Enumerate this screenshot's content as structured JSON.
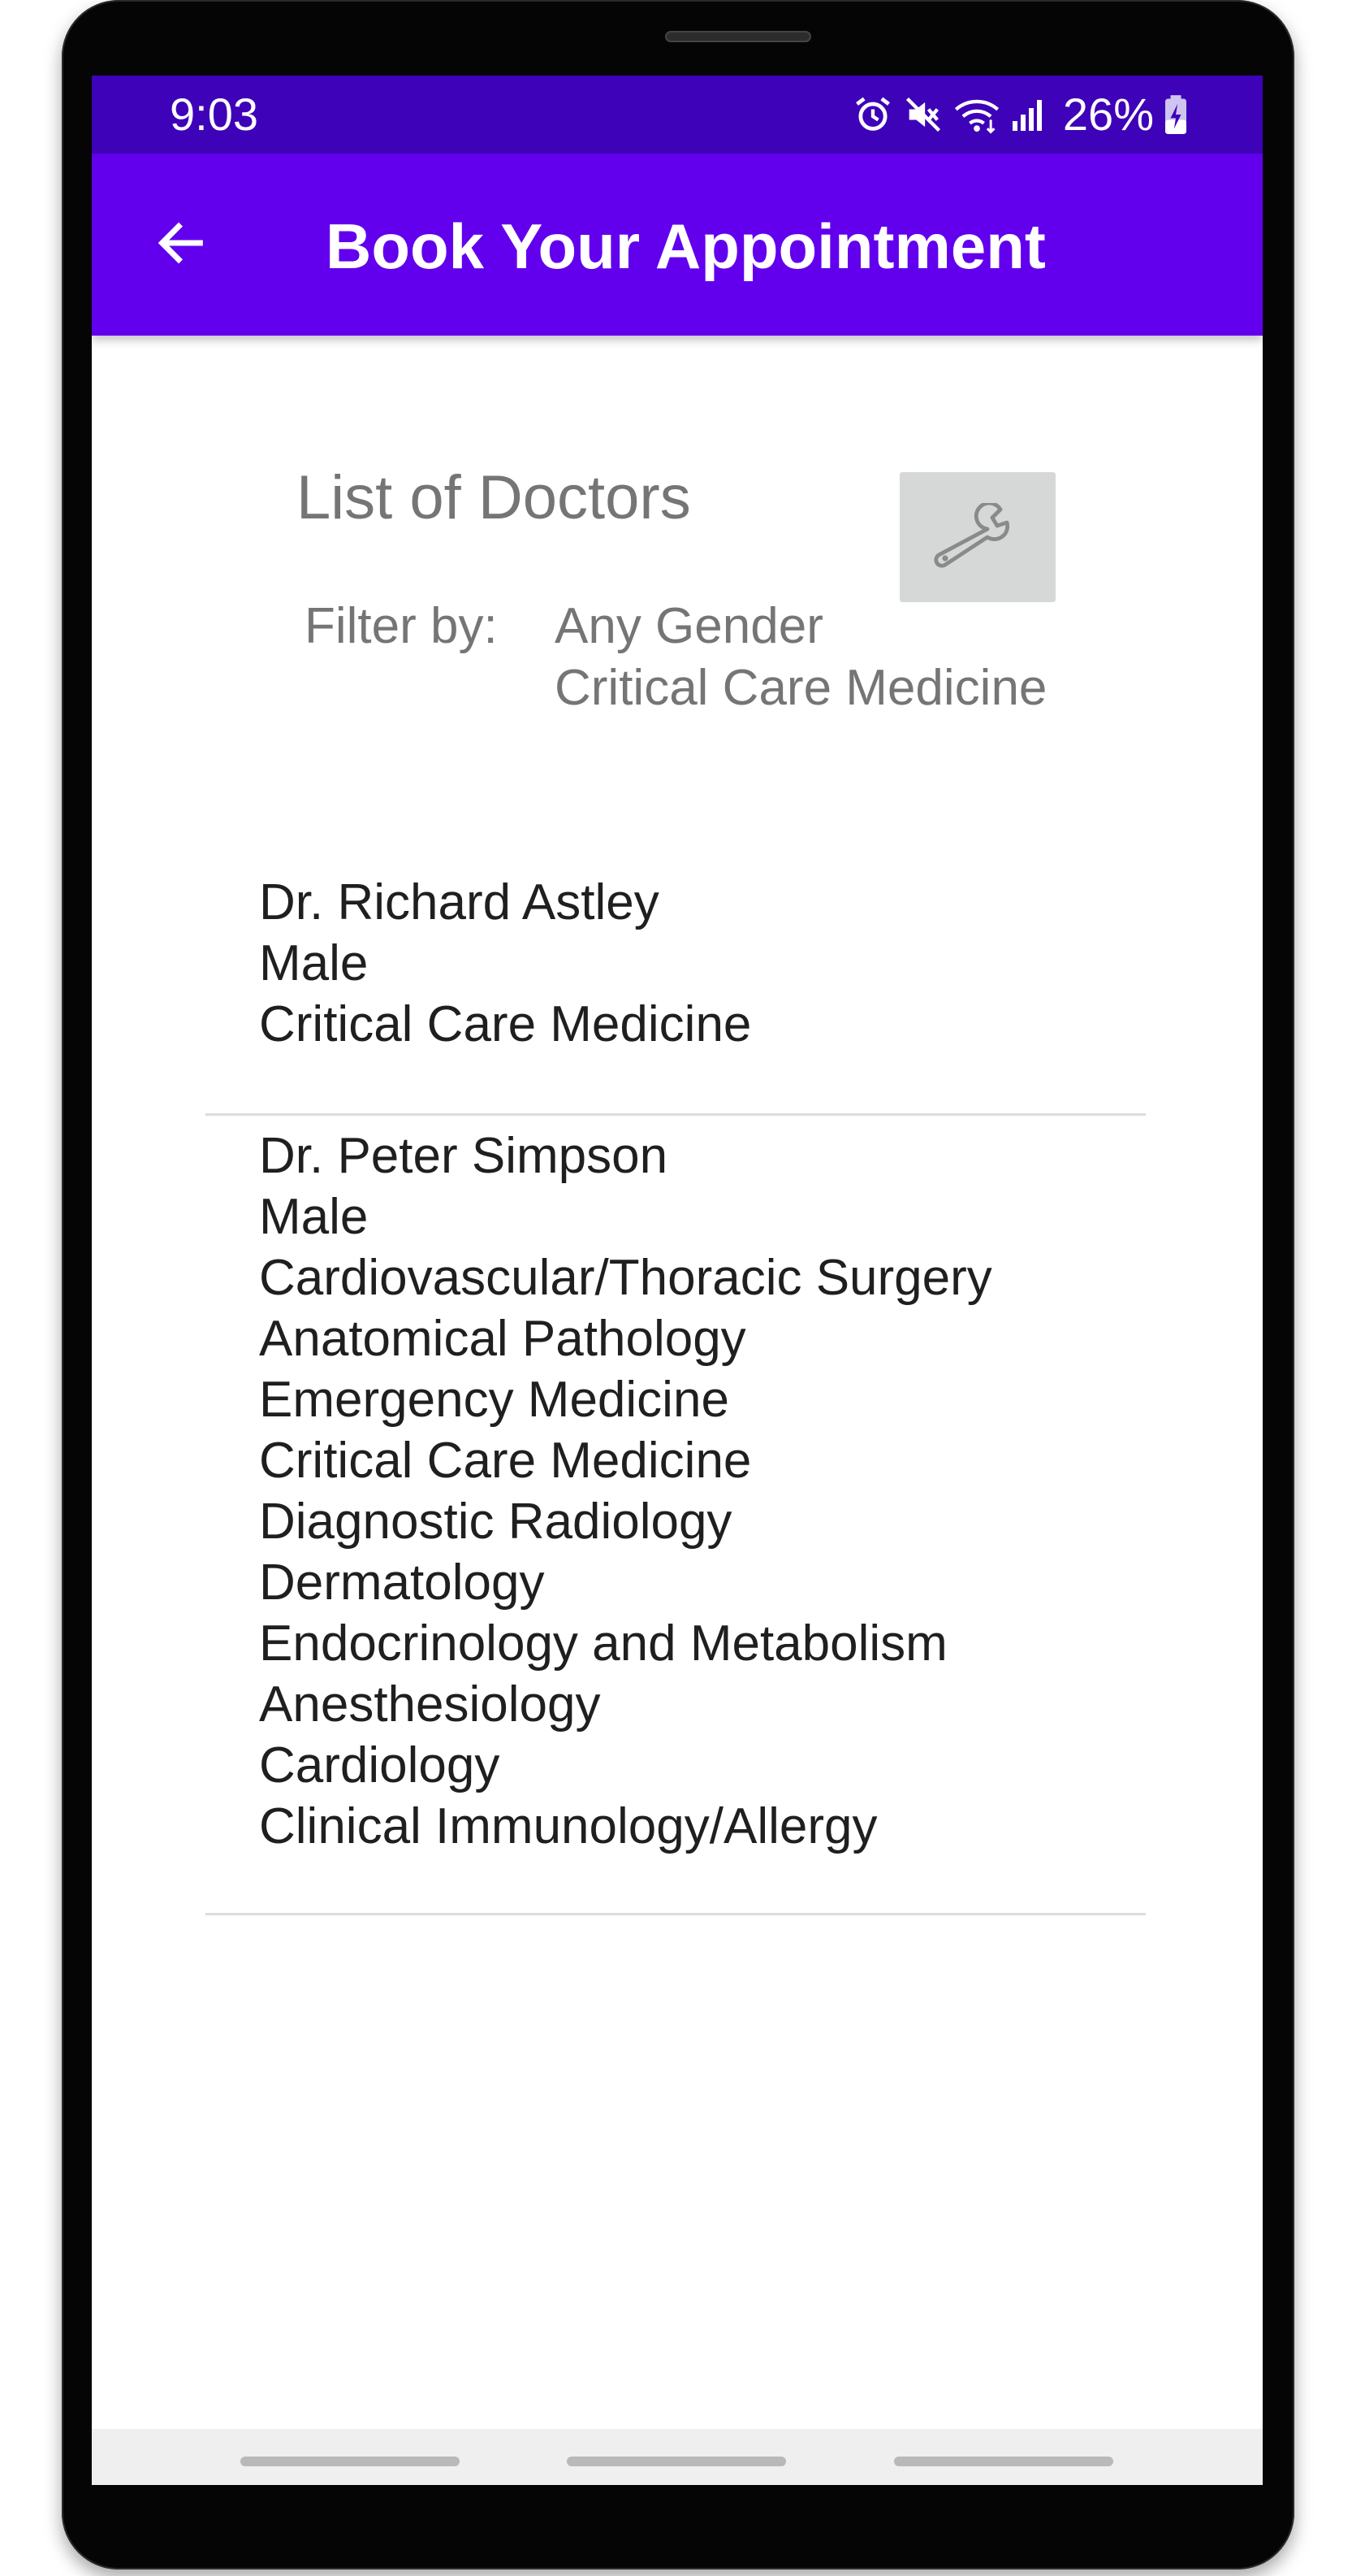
{
  "status_bar": {
    "time": "9:03",
    "battery_percent": "26%",
    "icons": [
      "alarm-icon",
      "mute-icon",
      "wifi-icon",
      "signal-icon",
      "battery-charging-icon"
    ]
  },
  "app_bar": {
    "title": "Book Your Appointment",
    "back_icon": "arrow-left-icon"
  },
  "header": {
    "title": "List of Doctors",
    "filter_button_icon": "wrench-icon",
    "filter_label": "Filter by:",
    "filter_gender": "Any Gender",
    "filter_specialty": "Critical Care Medicine"
  },
  "doctors": [
    {
      "name": "Dr. Richard Astley",
      "gender": "Male",
      "specialties": [
        "Critical Care Medicine"
      ]
    },
    {
      "name": "Dr. Peter Simpson",
      "gender": "Male",
      "specialties": [
        "Cardiovascular/Thoracic Surgery",
        "Anatomical Pathology",
        "Emergency Medicine",
        "Critical Care Medicine",
        "Diagnostic Radiology",
        "Dermatology",
        "Endocrinology and Metabolism",
        "Anesthesiology",
        "Cardiology",
        "Clinical Immunology/Allergy"
      ]
    }
  ],
  "colors": {
    "status_bar": "#3e02b8",
    "app_bar": "#6200ee",
    "header_text": "#757575",
    "list_text": "#1f1f1f",
    "filter_button_bg": "#d6d7d7"
  }
}
